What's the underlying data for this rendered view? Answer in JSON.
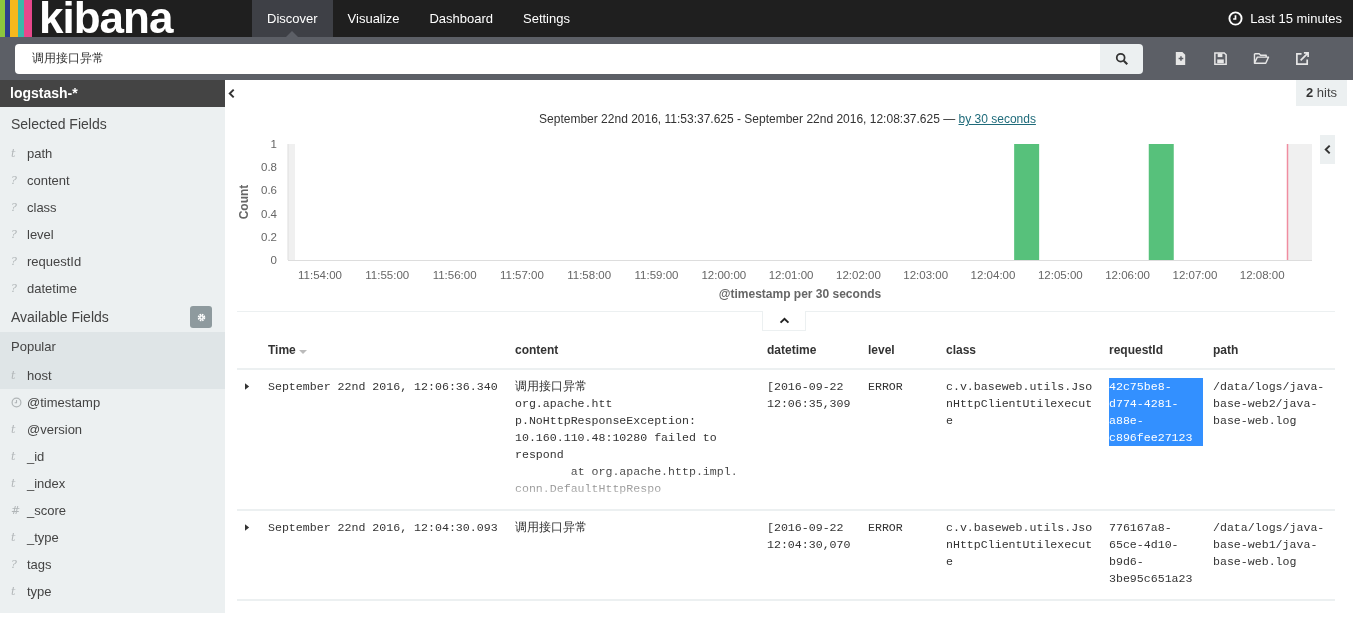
{
  "logo": {
    "text": "kibana"
  },
  "tabs": [
    {
      "label": "Discover",
      "selected": true
    },
    {
      "label": "Visualize",
      "selected": false
    },
    {
      "label": "Dashboard",
      "selected": false
    },
    {
      "label": "Settings",
      "selected": false
    }
  ],
  "time_picker": {
    "label": "Last 15 minutes"
  },
  "search": {
    "value": "调用接口异常"
  },
  "sidebar": {
    "index_pattern": "logstash-*",
    "selected_fields": {
      "label": "Selected Fields",
      "fields": [
        {
          "kind": "char",
          "icon": "t",
          "name": "path"
        },
        {
          "kind": "char",
          "icon": "?",
          "name": "content"
        },
        {
          "kind": "char",
          "icon": "?",
          "name": "class"
        },
        {
          "kind": "char",
          "icon": "?",
          "name": "level"
        },
        {
          "kind": "char",
          "icon": "?",
          "name": "requestId"
        },
        {
          "kind": "char",
          "icon": "?",
          "name": "datetime"
        }
      ]
    },
    "available_fields": {
      "label": "Available Fields",
      "popular": {
        "label": "Popular",
        "fields": [
          {
            "kind": "char",
            "icon": "t",
            "name": "host"
          }
        ]
      },
      "fields": [
        {
          "kind": "clock",
          "name": "@timestamp"
        },
        {
          "kind": "char",
          "icon": "t",
          "name": "@version"
        },
        {
          "kind": "char",
          "icon": "t",
          "name": "_id"
        },
        {
          "kind": "char",
          "icon": "t",
          "name": "_index"
        },
        {
          "kind": "char",
          "icon": "#",
          "name": "_score"
        },
        {
          "kind": "char",
          "icon": "t",
          "name": "_type"
        },
        {
          "kind": "char",
          "icon": "?",
          "name": "tags"
        },
        {
          "kind": "char",
          "icon": "t",
          "name": "type"
        }
      ]
    }
  },
  "hits": {
    "count": "2",
    "label": "hits"
  },
  "time_range": {
    "text": "September 22nd 2016, 11:53:37.625 - September 22nd 2016, 12:08:37.625 —",
    "interval_link": "by 30 seconds"
  },
  "histogram": {
    "chart_data": {
      "type": "bar",
      "xlabel": "@timestamp per 30 seconds",
      "ylabel": "Count",
      "categories": [
        null,
        "11:54:00",
        null,
        "11:55:00",
        null,
        "11:56:00",
        null,
        "11:57:00",
        null,
        "11:58:00",
        null,
        "11:59:00",
        null,
        "12:00:00",
        null,
        "12:01:00",
        null,
        "12:02:00",
        null,
        "12:03:00",
        null,
        "12:04:00",
        null,
        "12:05:00",
        null,
        "12:06:00",
        null,
        "12:07:00",
        null,
        "12:08:00",
        null
      ],
      "series": [
        {
          "color": "#57c17b",
          "values": [
            0,
            0,
            0,
            0,
            0,
            0,
            0,
            0,
            0,
            0,
            0,
            0,
            0,
            0,
            0,
            0,
            0,
            0,
            0,
            0,
            0,
            0,
            1,
            0,
            0,
            0,
            1,
            0,
            0,
            0,
            0
          ]
        }
      ],
      "ylim": [
        0,
        1
      ],
      "yticks": [
        0,
        0.2,
        0.4,
        0.6,
        0.8,
        1
      ]
    }
  },
  "table": {
    "columns": [
      {
        "label": "Time",
        "sorted": true
      },
      {
        "label": "content",
        "sorted": false
      },
      {
        "label": "datetime",
        "sorted": false
      },
      {
        "label": "level",
        "sorted": false
      },
      {
        "label": "class",
        "sorted": false
      },
      {
        "label": "requestId",
        "sorted": false
      },
      {
        "label": "path",
        "sorted": false
      }
    ],
    "rows": [
      {
        "time": "September 22nd 2016, 12:06:36.340",
        "content": "调用接口异常\norg.apache.htt\np.NoHttpResponseException:\n10.160.110.48:10280 failed to\nrespond\n\tat org.apache.http.impl.\nconn.DefaultHttpRespo",
        "content_truncated": true,
        "datetime": "[2016-09-22 12:06:35,309",
        "level": "ERROR",
        "class": "c.v.baseweb.utils.JsonHttpClientUtilexecute",
        "requestId": "42c75be8-d774-4281-a88e-c896fee27123",
        "requestId_selected": true,
        "path": "/data/logs/java-base-web2/java-base-web.log"
      },
      {
        "time": "September 22nd 2016, 12:04:30.093",
        "content": "调用接口异常",
        "datetime": "[2016-09-22 12:04:30,070",
        "level": "ERROR",
        "class": "c.v.baseweb.utils.JsonHttpClientUtilexecute",
        "requestId": "776167a8-65ce-4d10-b9d6-3be95c651a23",
        "requestId_selected": false,
        "path": "/data/logs/java-base-web1/java-base-web.log"
      }
    ]
  }
}
